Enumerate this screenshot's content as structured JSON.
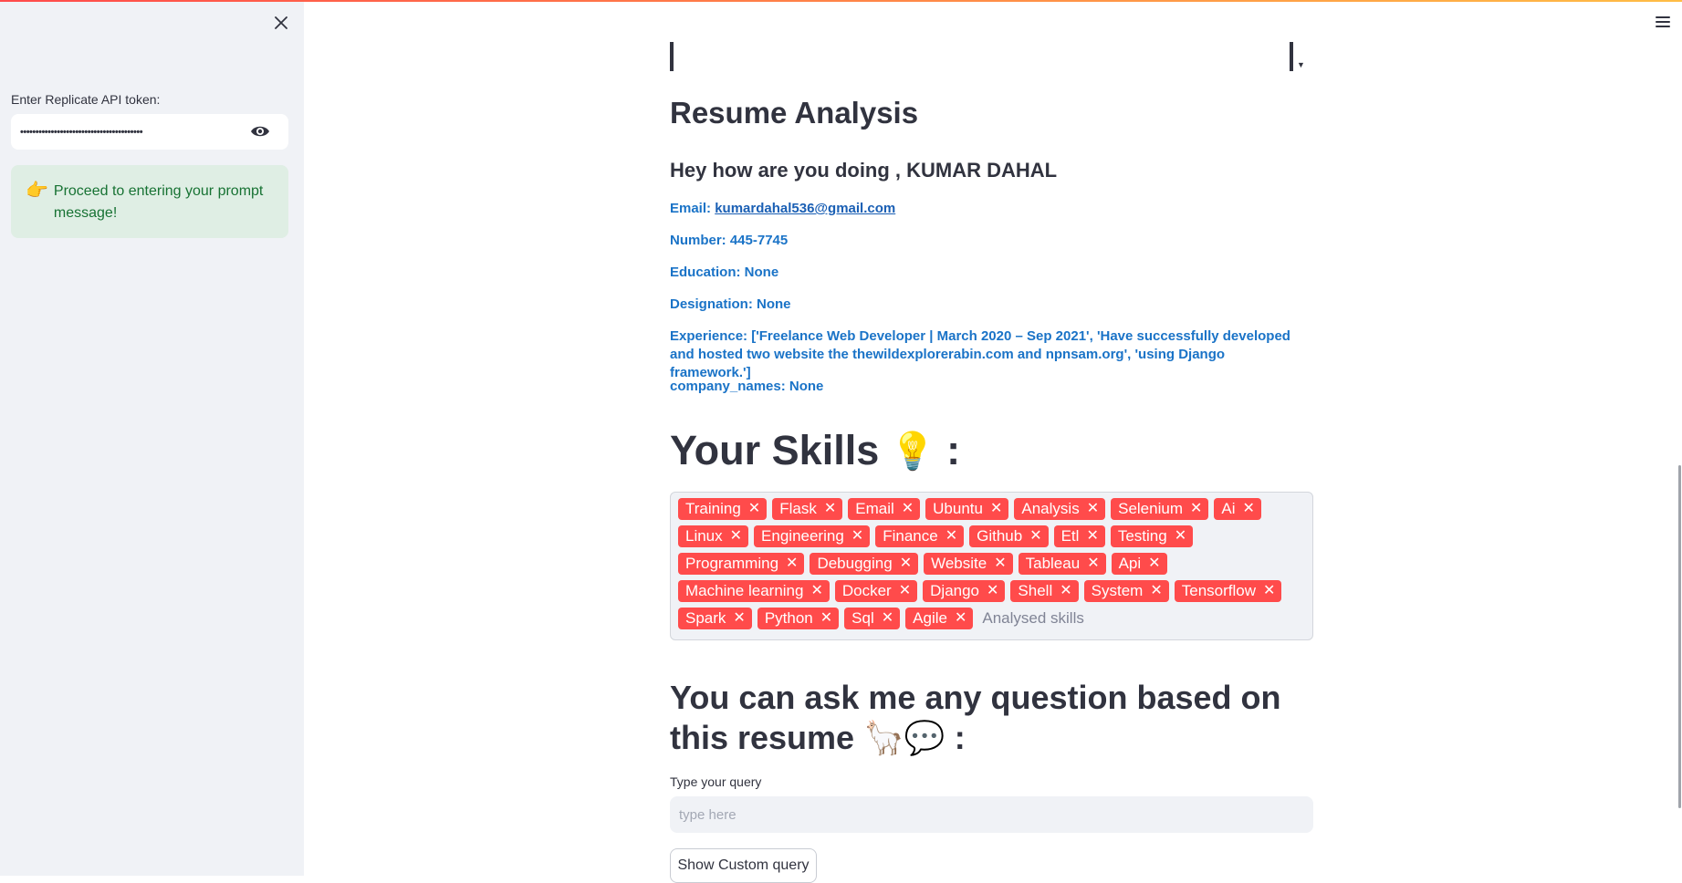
{
  "sidebar": {
    "token_label": "Enter Replicate API token:",
    "token_value": "••••••••••••••••••••••••••••••••••••••••",
    "alert_emoji": "👉",
    "alert_message": "Proceed to entering your prompt message!"
  },
  "main": {
    "title": "Resume Analysis",
    "greeting": "Hey how are you doing , KUMAR DAHAL",
    "email_label": "Email: ",
    "email_value": "kumardahal536@gmail.com",
    "number": "Number: 445-7745",
    "education": "Education: None",
    "designation": "Designation: None",
    "experience": "Experience: ['Freelance Web Developer | March 2020 – Sep 2021', 'Have successfully developed and hosted two website the thewildexplorerabin.com and npnsam.org', 'using Django framework.']",
    "company_names": "company_names: None",
    "skills_heading": "Your Skills",
    "skills_emoji": "💡",
    "skills_colon": ":",
    "skills": [
      "Training",
      "Flask",
      "Email",
      "Ubuntu",
      "Analysis",
      "Selenium",
      "Ai",
      "Linux",
      "Engineering",
      "Finance",
      "Github",
      "Etl",
      "Testing",
      "Programming",
      "Debugging",
      "Website",
      "Tableau",
      "Api",
      "Machine learning",
      "Docker",
      "Django",
      "Shell",
      "System",
      "Tensorflow",
      "Spark",
      "Python",
      "Sql",
      "Agile"
    ],
    "skills_placeholder": "Analysed skills",
    "ask_heading": "You can ask me any question based on this resume 🦙💬 :",
    "query_label": "Type your query",
    "query_placeholder": "type here",
    "query_value": "",
    "custom_button": "Show Custom query",
    "remove_glyph": "✕"
  },
  "colors": {
    "accent": "#ff4b4b",
    "sidebar_bg": "#f0f2f6",
    "info_blue": "#1a73c7",
    "success_text": "#177233",
    "success_bg": "#dfeee4"
  }
}
